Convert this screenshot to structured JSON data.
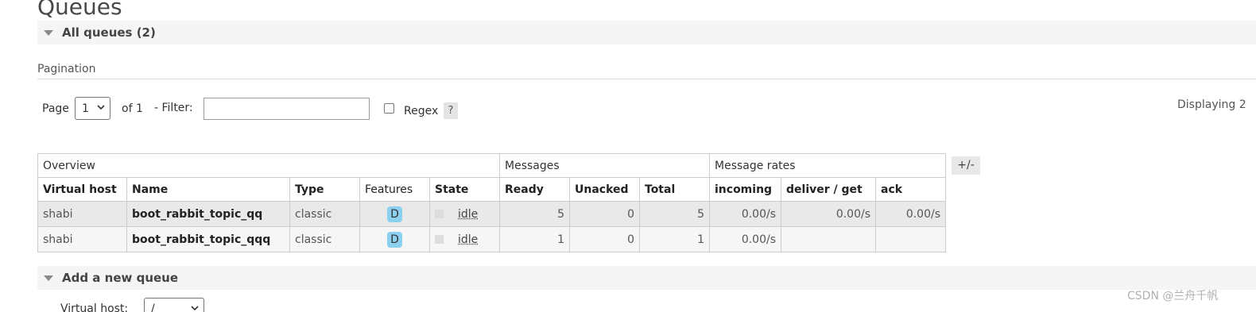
{
  "page": {
    "title": "Queues"
  },
  "all_queues": {
    "label": "All queues (2)"
  },
  "pagination": {
    "label": "Pagination",
    "page_label": "Page",
    "page_value": "1",
    "of_label": "of 1",
    "filter_label": "- Filter:",
    "filter_value": "",
    "regex_label": "Regex",
    "help_label": "?",
    "displaying": "Displaying 2"
  },
  "table": {
    "groups": [
      "Overview",
      "Messages",
      "Message rates"
    ],
    "columns": {
      "virtual_host": "Virtual host",
      "name": "Name",
      "type": "Type",
      "features": "Features",
      "state": "State",
      "ready": "Ready",
      "unacked": "Unacked",
      "total": "Total",
      "incoming": "incoming",
      "deliver_get": "deliver / get",
      "ack": "ack"
    },
    "rows": [
      {
        "vhost": "shabi",
        "name": "boot_rabbit_topic_qq",
        "type": "classic",
        "feature": "D",
        "state": "idle",
        "ready": "5",
        "unacked": "0",
        "total": "5",
        "incoming": "0.00/s",
        "deliver_get": "0.00/s",
        "ack": "0.00/s"
      },
      {
        "vhost": "shabi",
        "name": "boot_rabbit_topic_qqq",
        "type": "classic",
        "feature": "D",
        "state": "idle",
        "ready": "1",
        "unacked": "0",
        "total": "1",
        "incoming": "0.00/s",
        "deliver_get": "",
        "ack": ""
      }
    ],
    "plus_minus": "+/-"
  },
  "add_queue": {
    "label": "Add a new queue",
    "vhost_label": "Virtual host:",
    "vhost_value": "/"
  },
  "watermark": "CSDN @兰舟千帆",
  "colors": {
    "section_bg": "#f5f5f5",
    "row_odd": "#e9e9e9",
    "row_even": "#f6f6f6",
    "feature_badge": "#8cd0f0"
  }
}
